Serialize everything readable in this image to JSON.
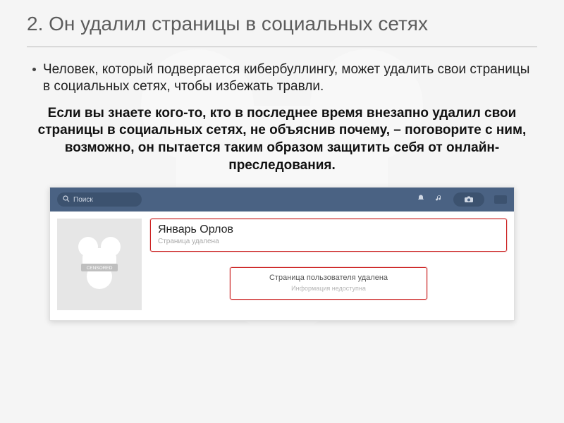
{
  "title": "2. Он удалил страницы в социальных сетях",
  "bullet": "Человек, который подвергается кибербуллингу, может удалить свои страницы в социальных сетях, чтобы избежать травли.",
  "bold_paragraph": "Если вы знаете кого-то, кто в последнее время внезапно удалил свои страницы в социальных сетях, не объяснив почему, – поговорите с ним, возможно, он пытается таким образом защитить себя от онлайн-преследования.",
  "social": {
    "search_placeholder": "Поиск",
    "avatar_label": "CENSORED",
    "person_name": "Январь Орлов",
    "person_subtitle": "Страница удалена",
    "deleted_title": "Страница пользователя удалена",
    "deleted_subtitle": "Информация недоступна"
  }
}
